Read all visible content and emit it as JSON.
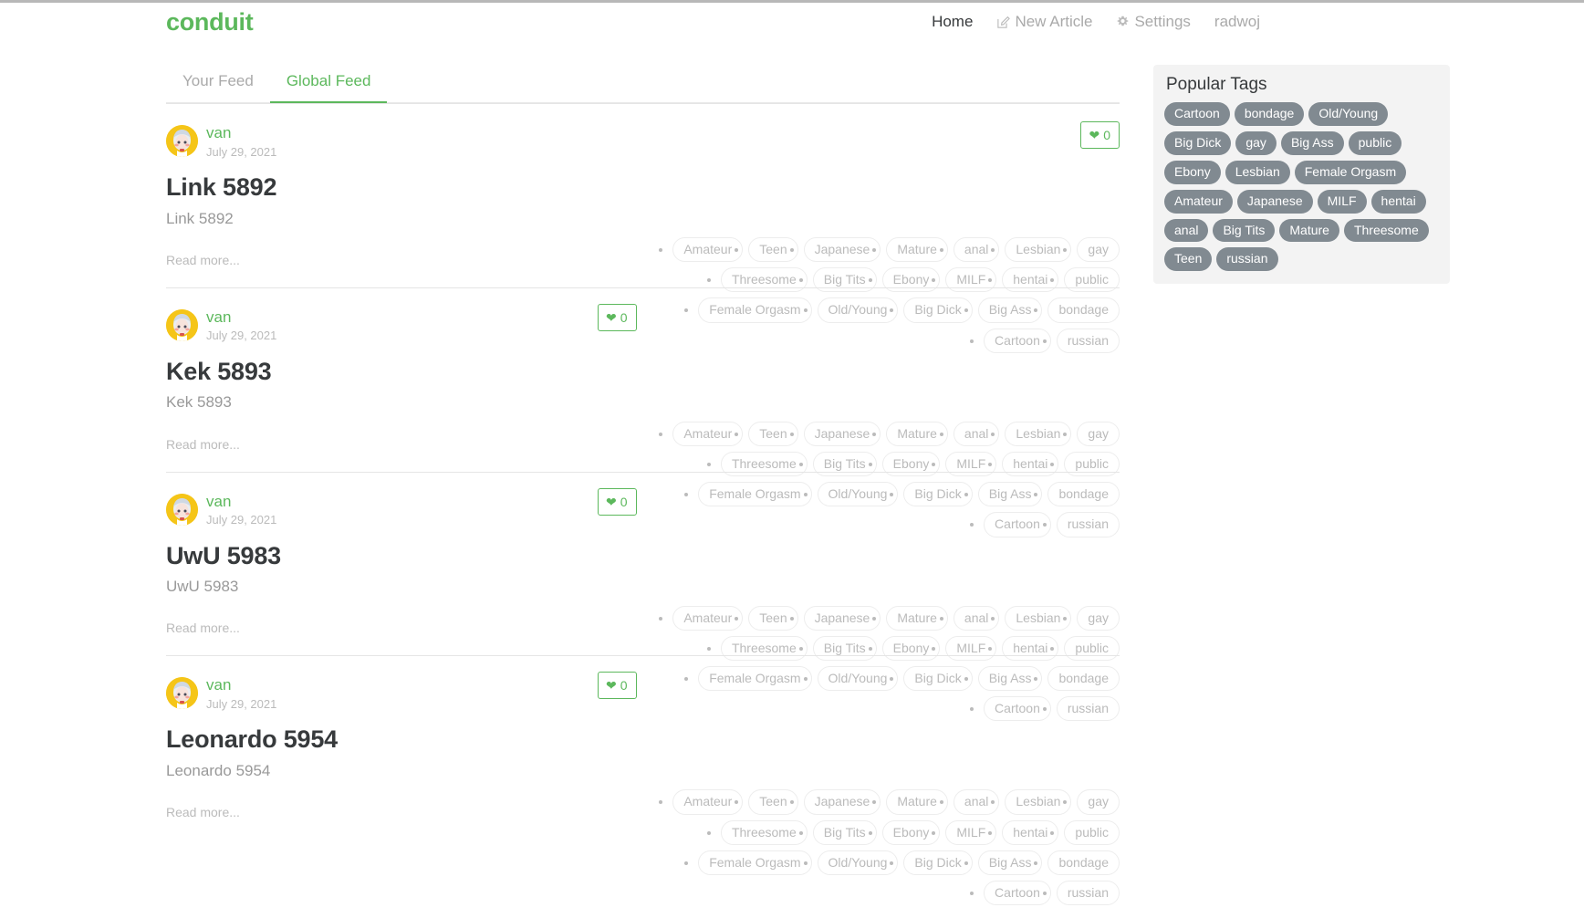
{
  "brand": "conduit",
  "nav": {
    "items": [
      {
        "label": "Home",
        "icon": null,
        "active": true
      },
      {
        "label": "New Article",
        "icon": "edit-icon",
        "active": false
      },
      {
        "label": "Settings",
        "icon": "gear-icon",
        "active": false
      },
      {
        "label": "radwoj",
        "icon": null,
        "active": false
      }
    ]
  },
  "tabs": [
    {
      "label": "Your Feed",
      "active": false
    },
    {
      "label": "Global Feed",
      "active": true
    }
  ],
  "read_more_label": "Read more...",
  "article_tags": [
    "Amateur",
    "Teen",
    "Japanese",
    "Mature",
    "anal",
    "Lesbian",
    "gay",
    "Threesome",
    "Big Tits",
    "Ebony",
    "MILF",
    "hentai",
    "public",
    "Female Orgasm",
    "Old/Young",
    "Big Dick",
    "Big Ass",
    "bondage",
    "Cartoon",
    "russian"
  ],
  "articles": [
    {
      "author": "van",
      "date": "July 29, 2021",
      "title": "Link 5892",
      "description": "Link 5892",
      "favorites_count": "0"
    },
    {
      "author": "van",
      "date": "July 29, 2021",
      "title": "Kek 5893",
      "description": "Kek 5893",
      "favorites_count": "0"
    },
    {
      "author": "van",
      "date": "July 29, 2021",
      "title": "UwU 5983",
      "description": "UwU 5983",
      "favorites_count": "0"
    },
    {
      "author": "van",
      "date": "July 29, 2021",
      "title": "Leonardo 5954",
      "description": "Leonardo 5954",
      "favorites_count": "0"
    }
  ],
  "sidebar": {
    "title": "Popular Tags",
    "tags": [
      "Cartoon",
      "bondage",
      "Old/Young",
      "Big Dick",
      "gay",
      "Big Ass",
      "public",
      "Ebony",
      "Lesbian",
      "Female Orgasm",
      "Amateur",
      "Japanese",
      "MILF",
      "hentai",
      "anal",
      "Big Tits",
      "Mature",
      "Threesome",
      "Teen",
      "russian"
    ]
  },
  "colors": {
    "brand_green": "#5cb85c",
    "tag_gray": "#818a91",
    "text_dark": "#373a3c",
    "muted": "#aaaaaa"
  }
}
